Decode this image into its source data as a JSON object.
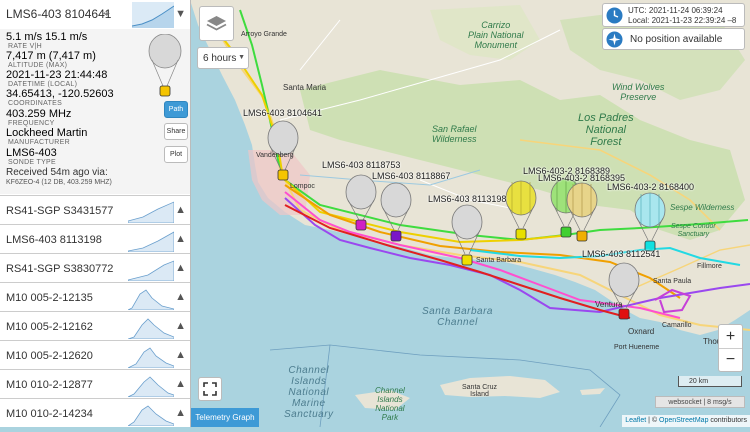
{
  "sidebar": {
    "selected": {
      "name": "LMS6-403 8104641",
      "rate_value": "5.1 m/s 15.1 m/s",
      "rate_label": "RATE V|H",
      "altitude_value": "7,417 m (7,417 m)",
      "altitude_label": "ALTITUDE (MAX)",
      "datetime_value": "2021-11-23 21:44:48",
      "datetime_label": "DATETIME (LOCAL)",
      "coords_value": "34.65413, -120.52603",
      "coords_label": "COORDINATES",
      "freq_value": "403.259 MHz",
      "freq_label": "FREQUENCY",
      "manufacturer_value": "Lockheed Martin",
      "manufacturer_label": "MANUFACTURER",
      "sonde_value": "LMS6-403",
      "sonde_label": "SONDE TYPE",
      "received_line1": "Received 54m ago via:",
      "received_line2": "KF6ZEO-4 (12 DB, 403.259 MHZ)",
      "path_label": "Path",
      "share_label": "Share",
      "plot_label": "Plot"
    },
    "items": [
      {
        "name": "RS41-SGP S3431577"
      },
      {
        "name": "LMS6-403 8113198"
      },
      {
        "name": "RS41-SGP S3830772"
      },
      {
        "name": "M10 005-2-12135"
      },
      {
        "name": "M10 005-2-12162"
      },
      {
        "name": "M10 005-2-12620"
      },
      {
        "name": "M10 010-2-12877"
      },
      {
        "name": "M10 010-2-14234"
      }
    ]
  },
  "map": {
    "hours_select": "6 hours",
    "time_utc": "UTC: 2021-11-24 06:39:24",
    "time_local": "Local: 2021-11-23 22:39:24 –8",
    "position_status": "No position available",
    "telemetry_tab": "Telemetry Graph",
    "zoom_in": "+",
    "zoom_out": "−",
    "scale": "20 km",
    "status": "websocket | 8 msg/s",
    "attribution_leaflet": "Leaflet",
    "attribution_sep": " | © ",
    "attribution_osm": "OpenStreetMap",
    "attribution_tail": " contributors",
    "balloons": [
      {
        "label": "LMS6-403 8104641",
        "color": "#f5c400"
      },
      {
        "label": "LMS6-403 8118753",
        "color": "#d01fc5"
      },
      {
        "label": "LMS6-403 8118867",
        "color": "#7a16c8"
      },
      {
        "label": "LMS6-403 8113198",
        "color": "#f0e000"
      },
      {
        "label": "LMS6-403-2 8168389",
        "color": "#e8e000"
      },
      {
        "label": "LMS6-403-2 8168395",
        "color": "#40d030"
      },
      {
        "label": "LMS6-403-2 8168400",
        "color": "#10e0e0"
      },
      {
        "label": "LMS6-403 8112541",
        "color": "#e01010"
      }
    ],
    "places": {
      "arroyo_grande": "Arroyo Grande",
      "santa_maria": "Santa Maria",
      "vandenberg": "Vandenberg",
      "lompoc": "Lompoc",
      "santa_barbara": "Santa Barbara",
      "fillmore": "Fillmore",
      "santa_paula": "Santa Paula",
      "ventura": "Ventura",
      "camarillo": "Camarillo",
      "oxnard": "Oxnard",
      "port_hueneme": "Port Hueneme",
      "thousand_oaks": "Thou",
      "carrizo": "Carrizo\nPlain National\nMonument",
      "wind_wolves": "Wind Wolves\nPreserve",
      "los_padres": "Los Padres\nNational\nForest",
      "san_rafael": "San Rafael\nWilderness",
      "sespe": "Sespe Condor\nSanctuary",
      "sespe_wild": "Sespe Wilderness",
      "channel_islands": "Channel\nIslands\nNational\nMarine\nSanctuary",
      "channel_islands_park": "Channel\nIslands\nNational\nPark",
      "santa_cruz": "Santa Cruz\nIsland",
      "sb_channel": "Santa Barbara\nChannel"
    }
  }
}
